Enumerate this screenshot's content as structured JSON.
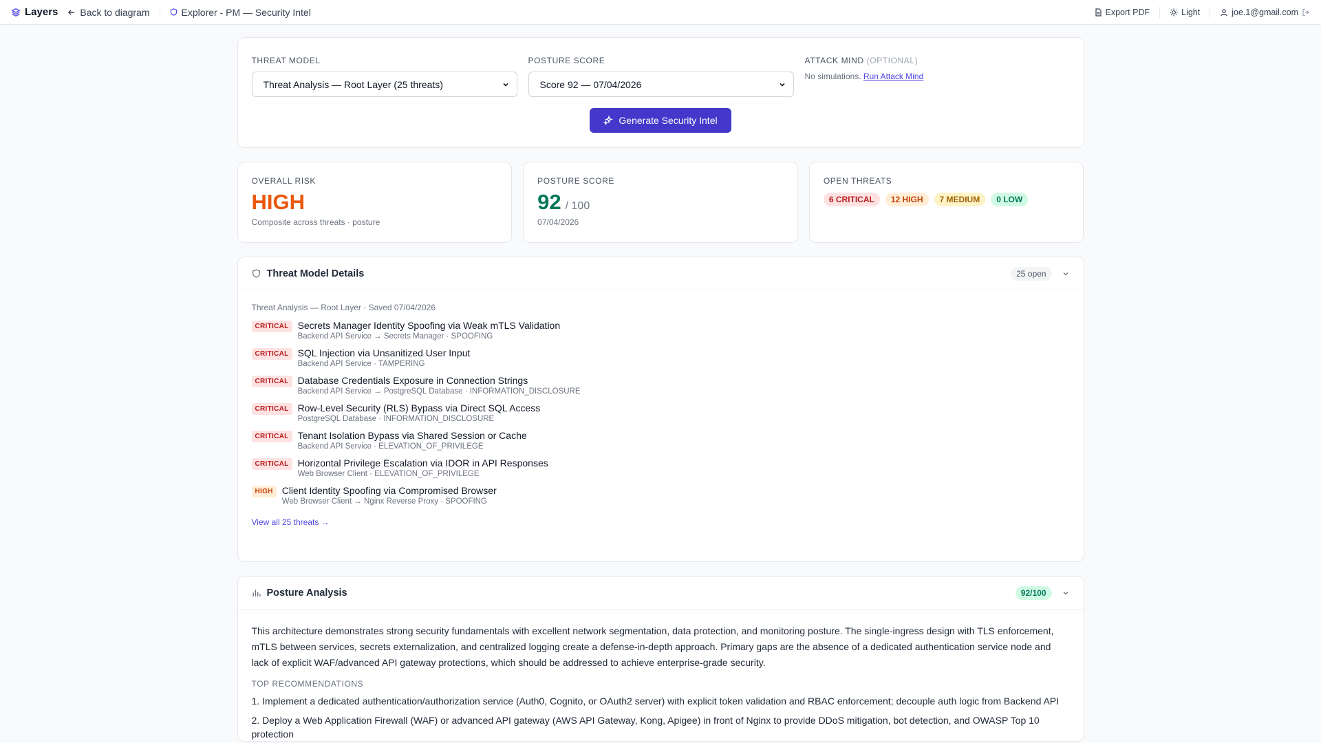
{
  "topbar": {
    "brand": "Layers",
    "back": "Back to diagram",
    "crumb": "Explorer - PM — Security Intel",
    "export": "Export PDF",
    "theme": "Light",
    "user": "joe.1@gmail.com"
  },
  "selectors": {
    "threat_model_label": "THREAT MODEL",
    "threat_model_value": "Threat Analysis — Root Layer (25 threats)",
    "posture_label": "POSTURE SCORE",
    "posture_value": "Score 92 — 07/04/2026",
    "attack_label": "ATTACK MIND",
    "attack_optional": "(OPTIONAL)",
    "attack_text": "No simulations.",
    "attack_link": "Run Attack Mind",
    "generate_button": "Generate Security Intel"
  },
  "stats": {
    "risk": {
      "label": "OVERALL RISK",
      "value": "HIGH",
      "sub": "Composite across threats · posture"
    },
    "posture": {
      "label": "POSTURE SCORE",
      "value": "92",
      "of": "/ 100",
      "date": "07/04/2026"
    },
    "open": {
      "label": "OPEN THREATS",
      "critical": "6 CRITICAL",
      "high": "12 HIGH",
      "medium": "7 MEDIUM",
      "low": "0 LOW"
    }
  },
  "threat_section": {
    "title": "Threat Model Details",
    "badge": "25 open",
    "meta": "Threat Analysis — Root Layer · Saved 07/04/2026",
    "threats": [
      {
        "severity": "CRITICAL",
        "title": "Secrets Manager Identity Spoofing via Weak mTLS Validation",
        "sub": "Backend API Service → Secrets Manager · SPOOFING"
      },
      {
        "severity": "CRITICAL",
        "title": "SQL Injection via Unsanitized User Input",
        "sub": "Backend API Service · TAMPERING"
      },
      {
        "severity": "CRITICAL",
        "title": "Database Credentials Exposure in Connection Strings",
        "sub": "Backend API Service → PostgreSQL Database · INFORMATION_DISCLOSURE"
      },
      {
        "severity": "CRITICAL",
        "title": "Row-Level Security (RLS) Bypass via Direct SQL Access",
        "sub": "PostgreSQL Database · INFORMATION_DISCLOSURE"
      },
      {
        "severity": "CRITICAL",
        "title": "Tenant Isolation Bypass via Shared Session or Cache",
        "sub": "Backend API Service · ELEVATION_OF_PRIVILEGE"
      },
      {
        "severity": "CRITICAL",
        "title": "Horizontal Privilege Escalation via IDOR in API Responses",
        "sub": "Web Browser Client · ELEVATION_OF_PRIVILEGE"
      },
      {
        "severity": "HIGH",
        "title": "Client Identity Spoofing via Compromised Browser",
        "sub": "Web Browser Client → Nginx Reverse Proxy · SPOOFING"
      }
    ],
    "view_all": "View all 25 threats →"
  },
  "posture_section": {
    "title": "Posture Analysis",
    "badge": "92/100",
    "text": "This architecture demonstrates strong security fundamentals with excellent network segmentation, data protection, and monitoring posture. The single-ingress design with TLS enforcement, mTLS between services, secrets externalization, and centralized logging create a defense-in-depth approach. Primary gaps are the absence of a dedicated authentication service node and lack of explicit WAF/advanced API gateway protections, which should be addressed to achieve enterprise-grade security.",
    "rec_label": "TOP RECOMMENDATIONS",
    "recs": [
      "1. Implement a dedicated authentication/authorization service (Auth0, Cognito, or OAuth2 server) with explicit token validation and RBAC enforcement; decouple auth logic from Backend API",
      "2. Deploy a Web Application Firewall (WAF) or advanced API gateway (AWS API Gateway, Kong, Apigee) in front of Nginx to provide DDoS mitigation, bot detection, and OWASP Top 10 protection"
    ]
  },
  "colors": {
    "accent": "#4338ca",
    "risk_high": "#ea580c",
    "score_green": "#047857",
    "critical": "#b91c1c",
    "high": "#c2410c",
    "medium": "#a16207",
    "low": "#047857"
  }
}
